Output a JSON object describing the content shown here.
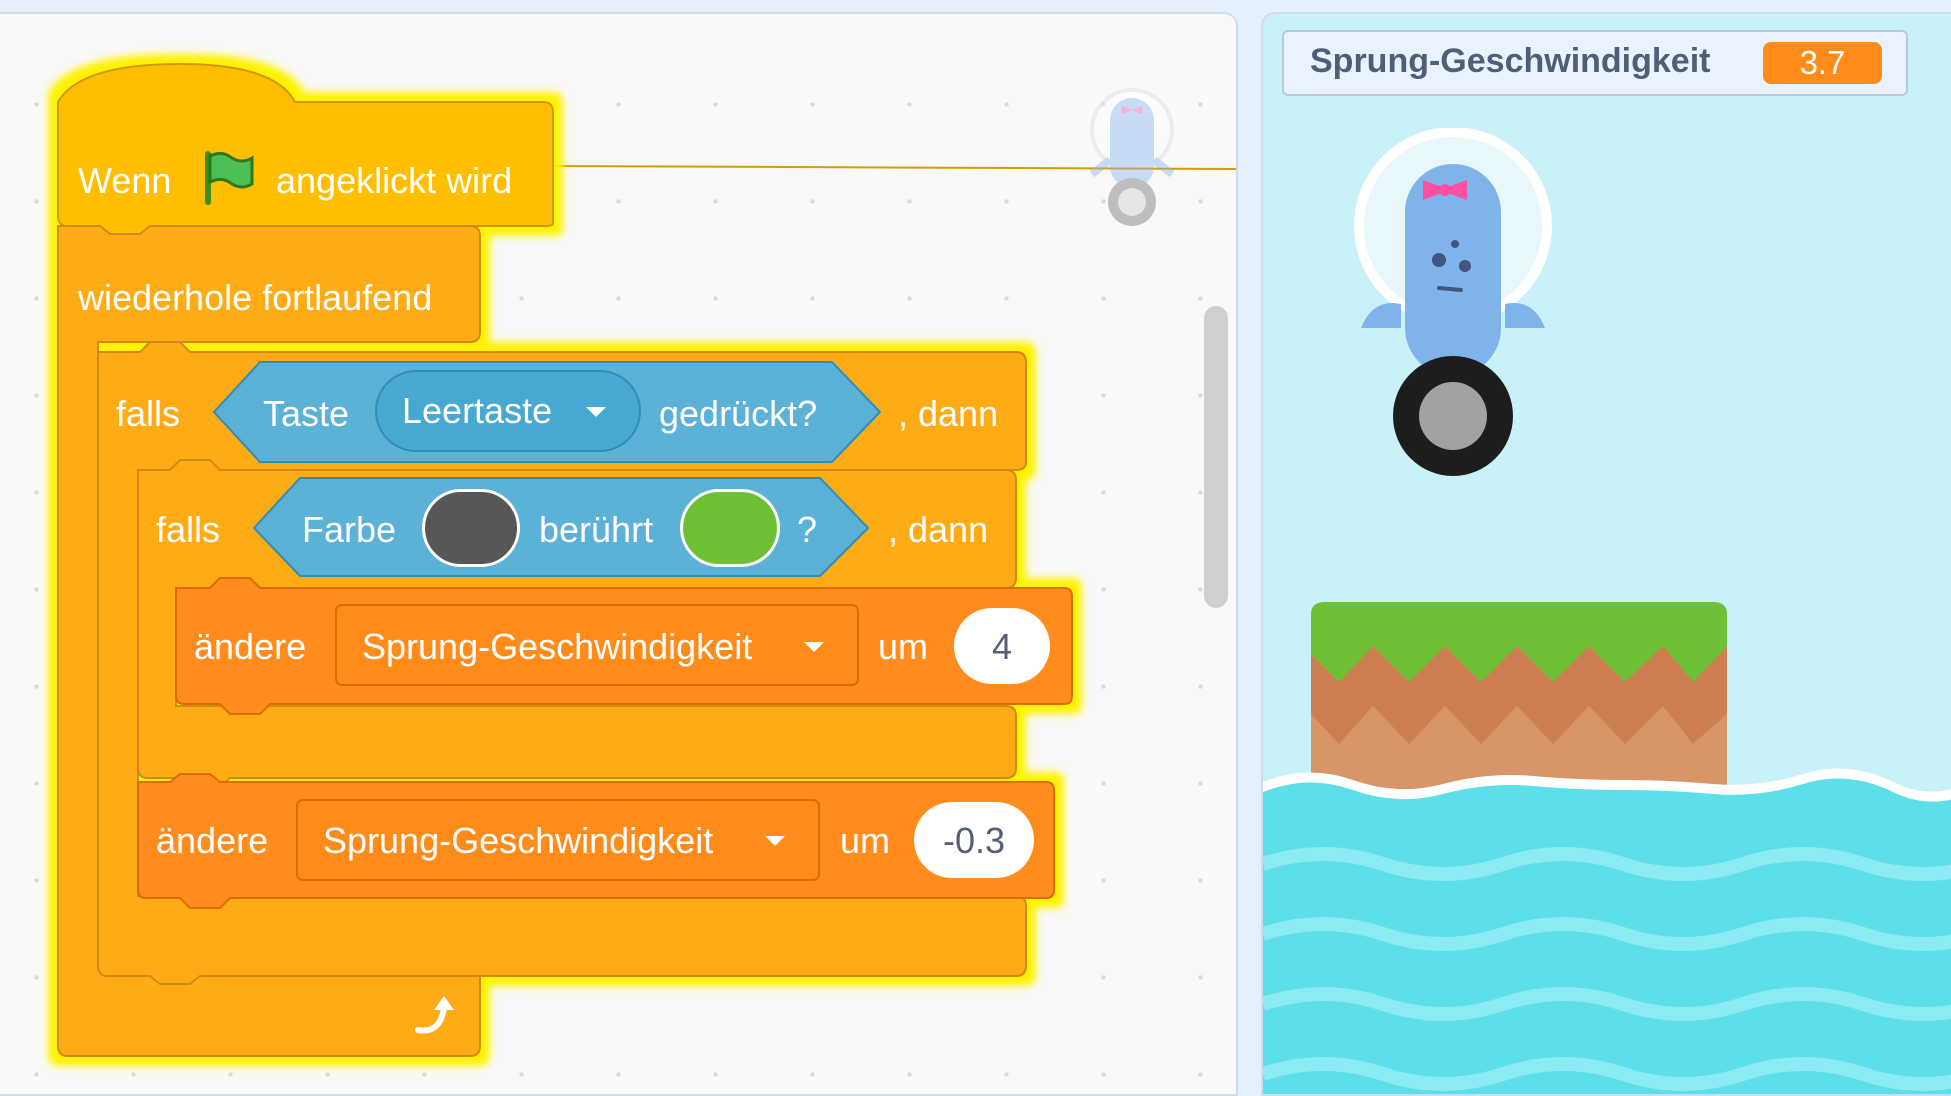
{
  "code": {
    "hat": {
      "when": "Wenn",
      "clicked": "angeklickt wird"
    },
    "forever": {
      "label": "wiederhole fortlaufend"
    },
    "if_outer": {
      "if": "falls",
      "then": ", dann",
      "key": "Taste",
      "key_value": "Leertaste",
      "pressed": "gedrückt?"
    },
    "if_inner": {
      "if": "falls",
      "then": ", dann",
      "color": "Farbe",
      "touches": "berührt",
      "question": "?",
      "color_1": "#575757",
      "color_2": "#6ec134"
    },
    "change_1": {
      "label": "ändere",
      "variable": "Sprung-Geschwindigkeit",
      "by": "um",
      "value": "4"
    },
    "change_2": {
      "label": "ändere",
      "variable": "Sprung-Geschwindigkeit",
      "by": "um",
      "value": "-0.3"
    }
  },
  "stage": {
    "monitor": {
      "label": "Sprung-Geschwindigkeit",
      "value": "3.7"
    }
  },
  "colors": {
    "events": "#ffbf00",
    "control": "#ffab19",
    "sensing": "#5cb1d6",
    "variables": "#ff8c1a",
    "glow": "#fff200"
  }
}
